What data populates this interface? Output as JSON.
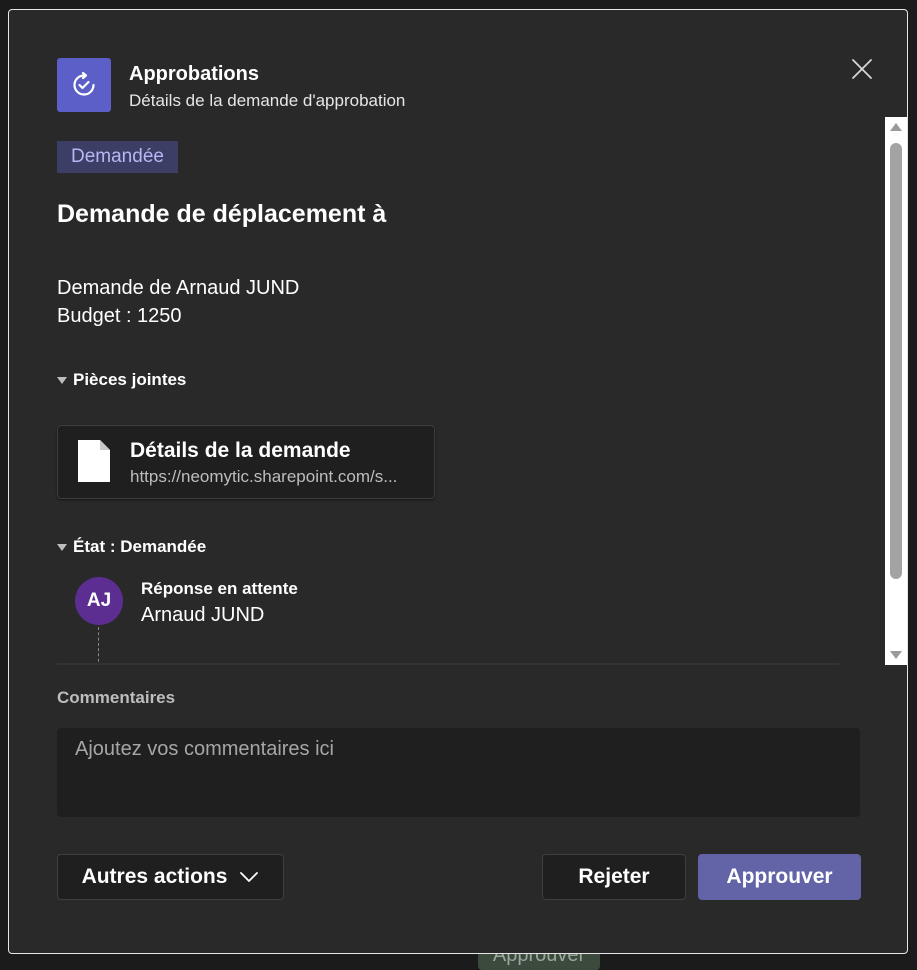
{
  "background": {
    "partial_button_label": "Approuver"
  },
  "header": {
    "app_title": "Approbations",
    "subtitle": "Détails de la demande d'approbation",
    "accent_color": "#5b5fc7",
    "app_icon": "approvals-icon",
    "close_icon": "close-icon"
  },
  "request": {
    "status_badge": "Demandée",
    "title": "Demande de déplacement à",
    "lines": [
      "Demande de Arnaud JUND",
      "Budget : 1250"
    ]
  },
  "attachments": {
    "section_label": "Pièces jointes",
    "items": [
      {
        "title": "Détails de la demande",
        "url": "https://neomytic.sharepoint.com/s...",
        "icon": "file-icon"
      }
    ]
  },
  "state": {
    "section_label": "État : Demandée",
    "responders": [
      {
        "initials": "AJ",
        "status": "Réponse en attente",
        "name": "Arnaud JUND",
        "avatar_color": "#5c2e91"
      }
    ]
  },
  "comments": {
    "label": "Commentaires",
    "placeholder": "Ajoutez vos commentaires ici",
    "value": ""
  },
  "actions": {
    "more_actions": "Autres actions",
    "reject": "Rejeter",
    "approve": "Approuver",
    "primary_color": "#6264a7"
  }
}
